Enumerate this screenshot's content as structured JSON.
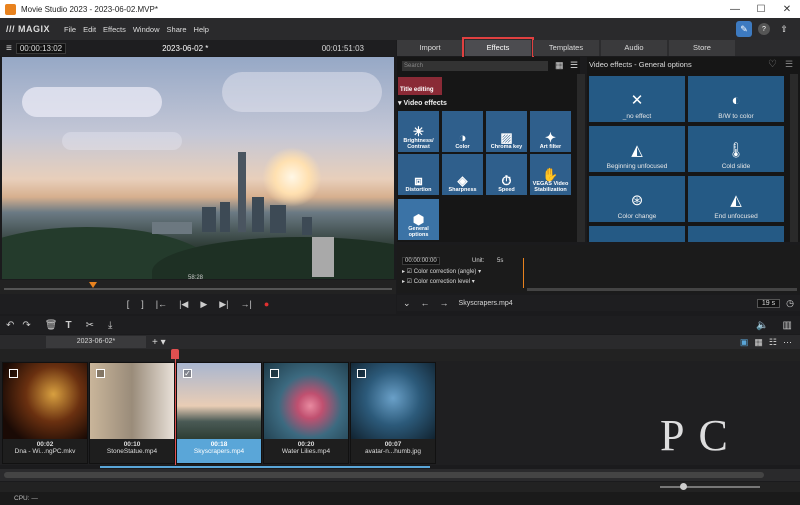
{
  "window": {
    "title": "Movie Studio 2023 - 2023-06-02.MVP*",
    "min": "—",
    "max": "☐",
    "close": "✕"
  },
  "menu": {
    "logo": "/// MAGIX",
    "items": [
      "File",
      "Edit",
      "Effects",
      "Window",
      "Share",
      "Help"
    ]
  },
  "monitor": {
    "timecode_left": "00:00:13:02",
    "title": "2023-06-02 *",
    "timecode_right": "00:01:51:03",
    "position": "58:28",
    "playhead_fraction": 0.23
  },
  "transport": {
    "buttons": [
      "[",
      "]",
      "|←",
      "|◀",
      "▶",
      "▶|",
      "→|",
      "●"
    ]
  },
  "right_tabs": {
    "items": [
      "Import",
      "Effects",
      "Templates",
      "Audio",
      "Store"
    ],
    "active": "Effects"
  },
  "library": {
    "search_placeholder": "Search",
    "title_editing": "Title editing",
    "section": "Video effects",
    "effects": [
      {
        "label": "Brightness/ Contrast",
        "icon": "☀"
      },
      {
        "label": "Color",
        "icon": "◑"
      },
      {
        "label": "Chroma key",
        "icon": "▨"
      },
      {
        "label": "Art filter",
        "icon": "✦"
      },
      {
        "label": "Distortion",
        "icon": "⧈"
      },
      {
        "label": "Sharpness",
        "icon": "◈"
      },
      {
        "label": "Speed",
        "icon": "⏱"
      },
      {
        "label": "VEGAS Video Stabilization",
        "icon": "✋"
      },
      {
        "label": "General options",
        "icon": "⬢"
      }
    ]
  },
  "presets": {
    "header": "Video effects - General options",
    "items": [
      {
        "label": "_no effect",
        "icon": "✕"
      },
      {
        "label": "B/W to color",
        "icon": "◐"
      },
      {
        "label": "Beginning unfocused",
        "icon": "◭"
      },
      {
        "label": "Cold slide",
        "icon": "🌡"
      },
      {
        "label": "Color change",
        "icon": "⊛"
      },
      {
        "label": "End unfocused",
        "icon": "◭"
      }
    ]
  },
  "keyframes": {
    "timecode": "00:00:00:00",
    "unit_label": "Unit:",
    "unit_value": "5s",
    "rows": [
      "Color correction (angle)",
      "Color correction level"
    ]
  },
  "right_bottom": {
    "clip": "Skyscrapers.mp4",
    "duration": "19 s"
  },
  "project_tab": "2023-06-02*",
  "clips": [
    {
      "name": "Dna - Wi...ngPC.mkv",
      "duration": "00:02",
      "checked": false,
      "selected": false
    },
    {
      "name": "StoneStatue.mp4",
      "duration": "00:10",
      "checked": false,
      "selected": false
    },
    {
      "name": "Skyscrapers.mp4",
      "duration": "00:18",
      "checked": true,
      "selected": true
    },
    {
      "name": "Water Lilies.mp4",
      "duration": "00:20",
      "checked": false,
      "selected": false
    },
    {
      "name": "avatar-n...humb.jpg",
      "duration": "00:07",
      "checked": false,
      "selected": false
    }
  ],
  "status": {
    "cpu": "CPU: —"
  },
  "watermark": "PC",
  "colors": {
    "accent": "#e8821e",
    "effect_tile": "#2f5f8c",
    "preset_tile": "#255a85",
    "selected": "#5aa6d8",
    "highlight": "#e04040"
  }
}
